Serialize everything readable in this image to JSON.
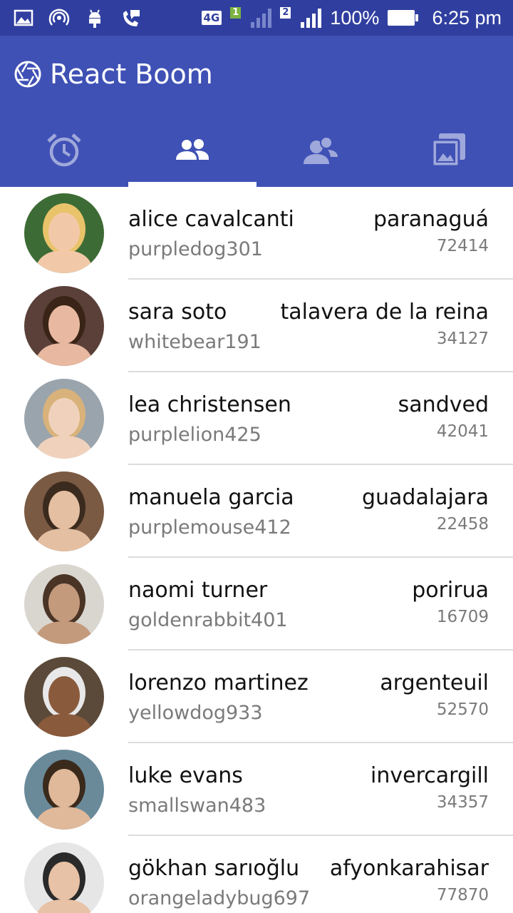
{
  "status_bar": {
    "network_type": "4G",
    "sim1_label": "1",
    "sim2_label": "2",
    "battery": "100%",
    "time": "6:25 pm",
    "icons": [
      "image-icon",
      "hotspot-icon",
      "android-debug-icon",
      "wifi-calling-icon"
    ]
  },
  "app": {
    "title": "React Boom",
    "logo_icon": "aperture-icon"
  },
  "tabs": [
    {
      "icon": "alarm-icon",
      "active": false
    },
    {
      "icon": "people-icon",
      "active": true
    },
    {
      "icon": "contacts-icon",
      "active": false
    },
    {
      "icon": "gallery-icon",
      "active": false
    }
  ],
  "colors": {
    "status_bar": "#303f9f",
    "primary": "#3f51b5",
    "tab_inactive": "#9fa8da",
    "divider": "#dcdcdc"
  },
  "users": [
    {
      "name": "alice cavalcanti",
      "username": "purpledog301",
      "city": "paranaguá",
      "postcode": "72414"
    },
    {
      "name": "sara soto",
      "username": "whitebear191",
      "city": "talavera de la reina",
      "postcode": "34127"
    },
    {
      "name": "lea christensen",
      "username": "purplelion425",
      "city": "sandved",
      "postcode": "42041"
    },
    {
      "name": "manuela garcia",
      "username": "purplemouse412",
      "city": "guadalajara",
      "postcode": "22458"
    },
    {
      "name": "naomi turner",
      "username": "goldenrabbit401",
      "city": "porirua",
      "postcode": "16709"
    },
    {
      "name": "lorenzo martinez",
      "username": "yellowdog933",
      "city": "argenteuil",
      "postcode": "52570"
    },
    {
      "name": "luke evans",
      "username": "smallswan483",
      "city": "invercargill",
      "postcode": "34357"
    },
    {
      "name": "gökhan sarıoğlu",
      "username": "orangeladybug697",
      "city": "afyonkarahisar",
      "postcode": "77870"
    }
  ]
}
